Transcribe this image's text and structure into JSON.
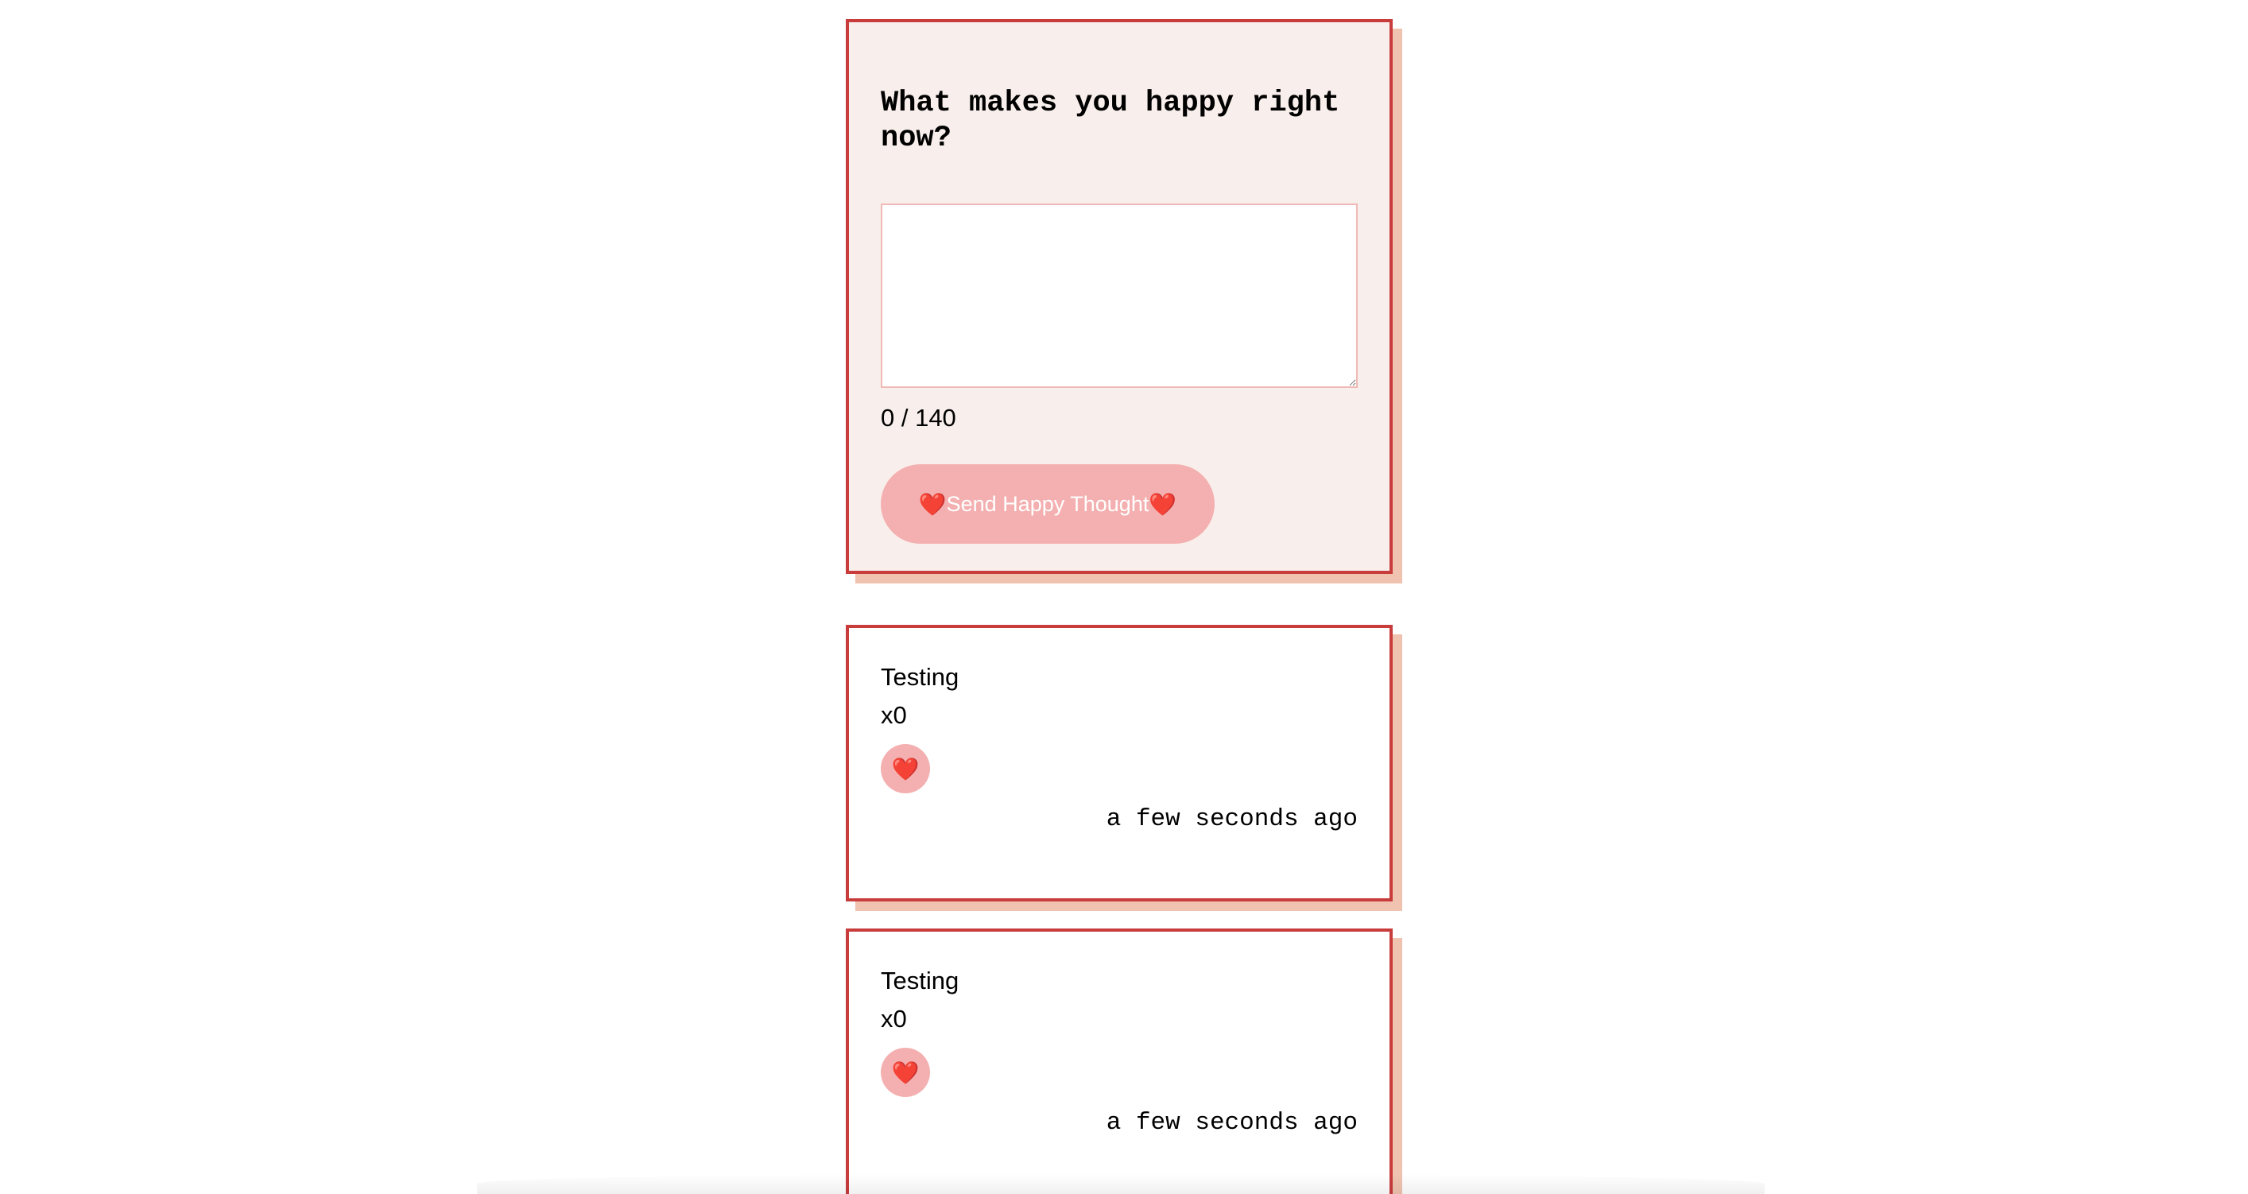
{
  "form": {
    "title": "What makes you happy right now?",
    "input_value": "",
    "counter": "0 / 140",
    "heart_left": "❤️",
    "send_label": "Send Happy Thought",
    "heart_right": "❤️"
  },
  "thoughts": [
    {
      "message": "Testing",
      "likes": "x0",
      "heart": "❤️",
      "time": "a few seconds ago"
    },
    {
      "message": "Testing",
      "likes": "x0",
      "heart": "❤️",
      "time": "a few seconds ago"
    }
  ],
  "colors": {
    "border": "#c93c3c",
    "shadow": "#f0c3b0",
    "form_bg": "#f8eeeb",
    "button_bg": "#f4b0b0",
    "input_border": "#f0b9b6"
  }
}
